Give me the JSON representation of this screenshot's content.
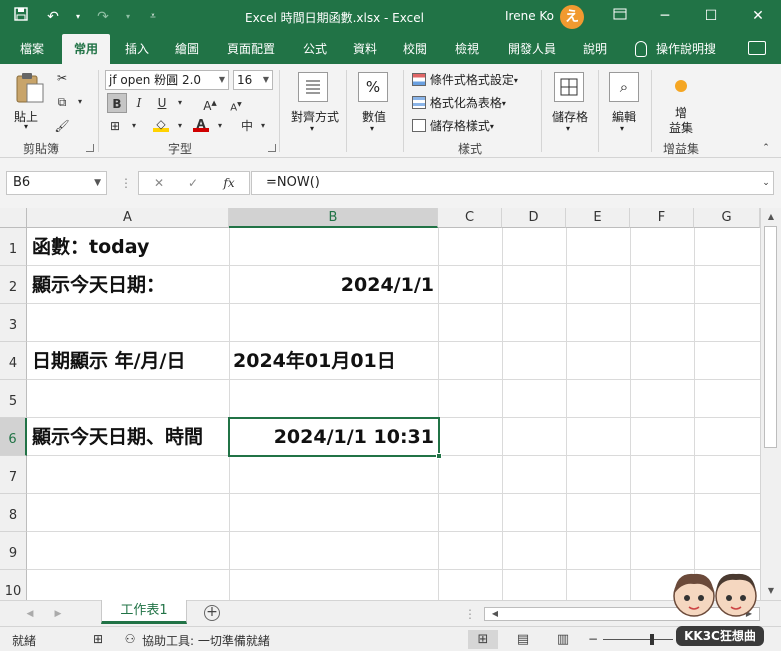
{
  "window": {
    "title": "Excel 時間日期函數.xlsx  -  Excel",
    "user": "Irene Ko",
    "avatar_letter": "え",
    "icons": [
      "save-icon",
      "undo-icon",
      "redo-icon",
      "customize-qat-icon",
      "ribbon-display-icon",
      "minimize-icon",
      "maximize-icon",
      "close-icon"
    ]
  },
  "tabs": [
    "檔案",
    "常用",
    "插入",
    "繪圖",
    "頁面配置",
    "公式",
    "資料",
    "校閱",
    "檢視",
    "開發人員",
    "說明",
    "操作說明搜"
  ],
  "active_tab": "常用",
  "ribbon": {
    "clipboard": {
      "paste": "貼上",
      "label": "剪貼簿"
    },
    "font": {
      "name": "jf open 粉圓 2.0",
      "size": "16",
      "bold": "B",
      "italic": "I",
      "underline": "U",
      "grow": "A",
      "shrink": "A",
      "font_color_letter": "A",
      "phonetic": "中",
      "label": "字型"
    },
    "alignment": {
      "label": "對齊方式"
    },
    "number": {
      "symbol": "%",
      "label": "數值"
    },
    "styles": {
      "conditional": "條件式格式設定",
      "as_table": "格式化為表格",
      "cell_styles": "儲存格樣式",
      "label": "樣式"
    },
    "cells": {
      "label": "儲存格"
    },
    "editing": {
      "label": "編輯"
    },
    "addins": {
      "button": "增\n益集",
      "button_line1": "增",
      "button_line2": "益集",
      "label": "增益集"
    },
    "colors": {
      "highlight": "#ffd200",
      "font_color": "#d00000",
      "addin_dot": "#f5a623"
    }
  },
  "formula_bar": {
    "name_box": "B6",
    "cancel": "✕",
    "enter": "✓",
    "fx": "fx",
    "formula": "=NOW()"
  },
  "grid": {
    "columns": [
      "A",
      "B",
      "C",
      "D",
      "E",
      "F",
      "G"
    ],
    "selected_column": "B",
    "rows": [
      "1",
      "2",
      "3",
      "4",
      "5",
      "6",
      "7",
      "8",
      "9",
      "10"
    ],
    "selected_row": "6",
    "cells": {
      "A1": "函數：today",
      "A2": "顯示今天日期：",
      "B2": "2024/1/1",
      "A4": "日期顯示 年/月/日",
      "B4": "2024年01月01日",
      "A6": "顯示今天日期、時間",
      "B6": "2024/1/1 10:31"
    }
  },
  "sheets": {
    "tabs": [
      "工作表1"
    ],
    "active": "工作表1",
    "add": "+"
  },
  "status": {
    "ready": "就緒",
    "accessibility": "協助工具: 一切準備就緒",
    "watermark": "KK3C狂想曲"
  },
  "accent_color": "#217346"
}
